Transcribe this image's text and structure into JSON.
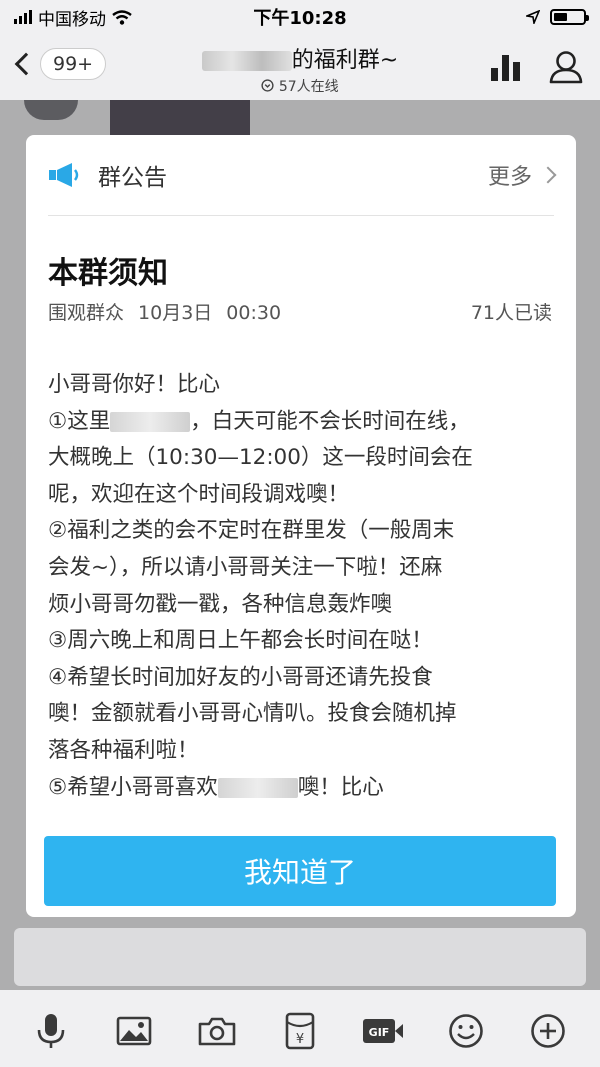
{
  "status_bar": {
    "carrier": "中国移动",
    "time": "下午10:28"
  },
  "nav": {
    "unread_count": "99+",
    "title_suffix": "的福利群~",
    "online_count": "57人在线"
  },
  "announcement": {
    "header_label": "群公告",
    "more_label": "更多",
    "title": "本群须知",
    "author": "围观群众",
    "date": "10月3日",
    "time": "00:30",
    "read_count": "71人已读",
    "body_lines": [
      "小哥哥你好！比心",
      "①这里",
      "，白天可能不会长时间在线，",
      "大概晚上（10:30—12:00）这一段时间会在",
      "呢，欢迎在这个时间段调戏噢！",
      "②福利之类的会不定时在群里发（一般周末",
      "会发~），所以请小哥哥关注一下啦！还麻",
      "烦小哥哥勿戳一戳，各种信息轰炸噢",
      "③周六晚上和周日上午都会长时间在哒！",
      "④希望长时间加好友的小哥哥还请先投食",
      "噢！金额就看小哥哥心情叭。投食会随机掉",
      "落各种福利啦！",
      "⑤希望小哥哥喜欢",
      "噢！比心"
    ],
    "confirm_label": "我知道了"
  },
  "colors": {
    "accent": "#2fb4f0",
    "icon_blue": "#2aa8e6"
  },
  "toolbar_icons": [
    "mic-icon",
    "image-icon",
    "camera-icon",
    "red-packet-icon",
    "gif-icon",
    "emoji-icon",
    "plus-icon"
  ]
}
